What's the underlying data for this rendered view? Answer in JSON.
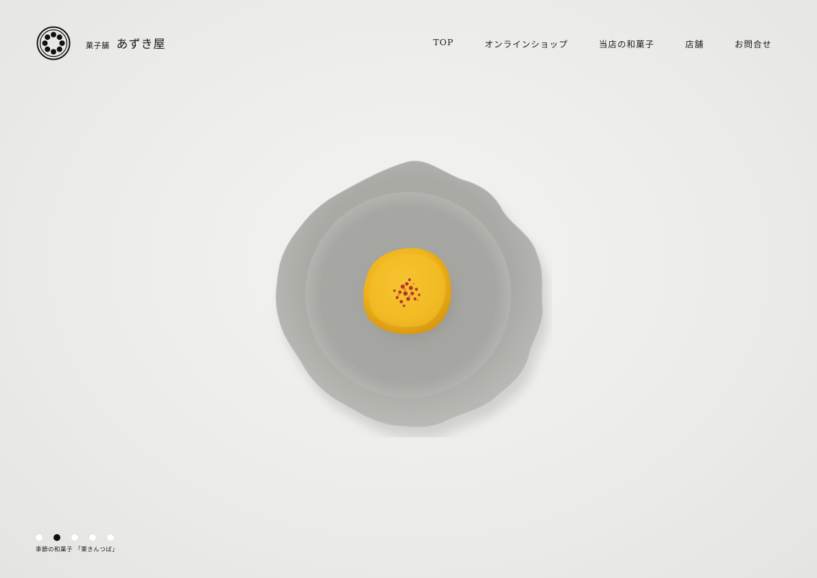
{
  "brand": {
    "sub": "菓子舗",
    "name": "あずき屋",
    "logo_icon": "family-crest-circle-of-dots-icon"
  },
  "nav": {
    "items": [
      {
        "label": "TOP"
      },
      {
        "label": "オンラインショップ"
      },
      {
        "label": "当店の和菓子"
      },
      {
        "label": "店舗"
      },
      {
        "label": "お問合せ"
      }
    ]
  },
  "hero": {
    "image": "scalloped-grey-plate-with-yellow-chestnut-sweet",
    "colors": {
      "plate": "#a9aaa5",
      "sweet": "#f2b81e",
      "topping": "#c0392b"
    }
  },
  "slider": {
    "count": 5,
    "active_index": 1,
    "caption": "季節の和菓子 「栗きんつば」"
  },
  "colors": {
    "background": "#ececea",
    "text": "#1a1a1a",
    "dot_active": "#111111",
    "dot_inactive": "#ffffff"
  }
}
